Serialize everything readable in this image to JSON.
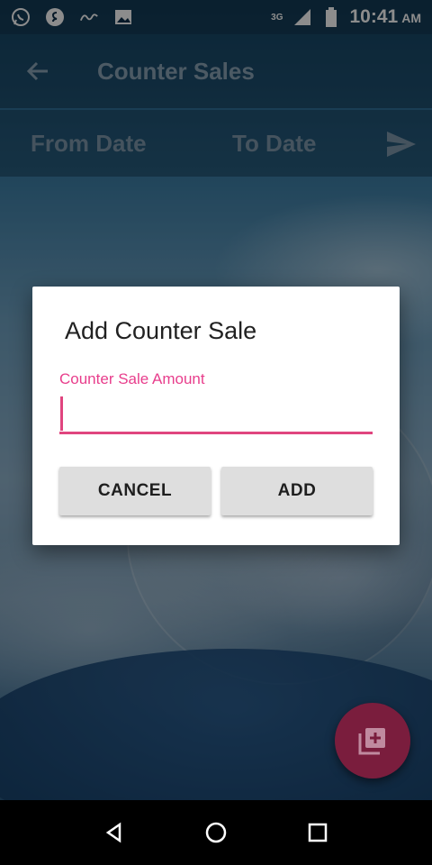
{
  "status_bar": {
    "time": "10:41",
    "ampm": "AM",
    "network": "3G",
    "icons": [
      "whatsapp-icon",
      "shazam-icon",
      "script-app-icon",
      "gallery-icon",
      "signal-icon",
      "battery-icon"
    ]
  },
  "toolbar": {
    "title": "Counter Sales",
    "back_icon": "arrow-left-icon"
  },
  "filter_bar": {
    "from_label": "From Date",
    "to_label": "To Date",
    "send_icon": "send-icon"
  },
  "dialog": {
    "title": "Add Counter Sale",
    "field_label": "Counter Sale Amount",
    "field_value": "",
    "cancel_label": "CANCEL",
    "add_label": "ADD"
  },
  "fab": {
    "icon": "add-to-library-icon"
  },
  "colors": {
    "accent": "#E83E8C",
    "fab": "#7A1D3D",
    "button_bg": "#DEDEDE"
  }
}
